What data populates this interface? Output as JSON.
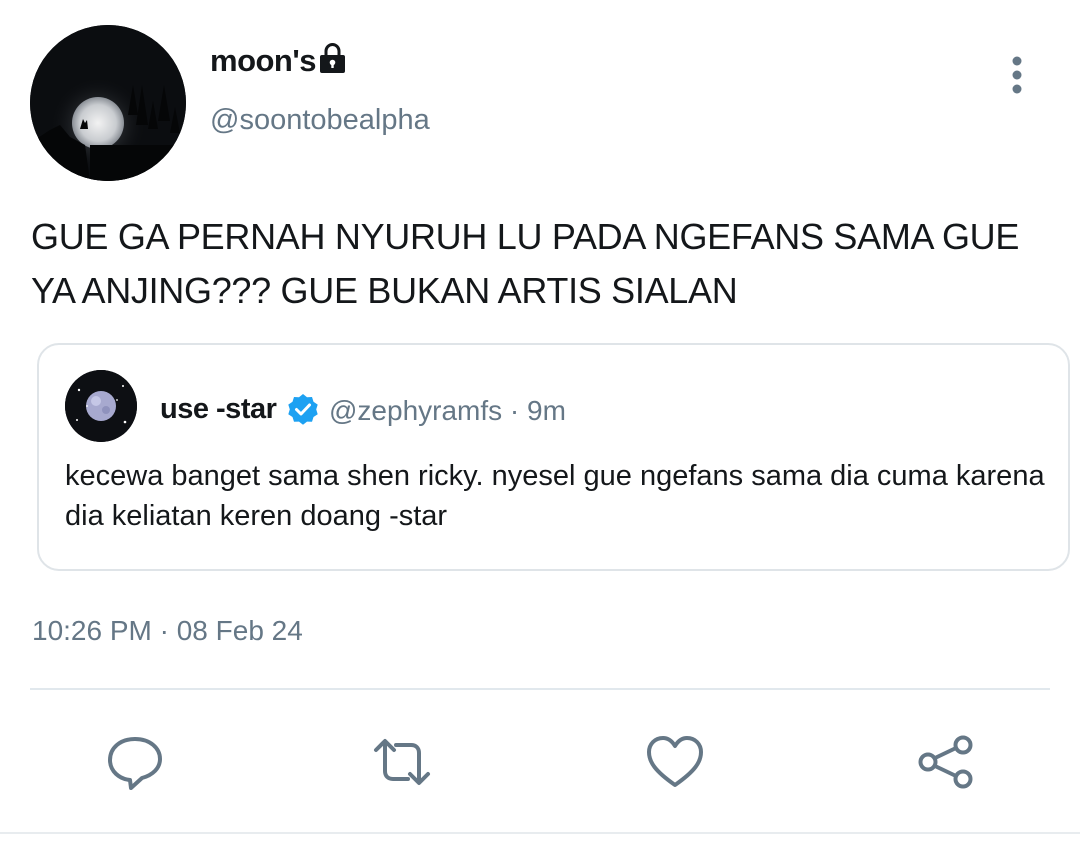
{
  "tweet": {
    "display_name": "moon's",
    "handle": "@soontobealpha",
    "text": "GUE GA PERNAH NYURUH LU PADA NGEFANS SAMA GUE YA ANJING??? GUE BUKAN ARTIS SIALAN",
    "timestamp": "10:26 PM · 08 Feb 24",
    "locked": true
  },
  "quoted_tweet": {
    "display_name": "use -star",
    "verified": true,
    "handle_time": "@zephyramfs · 9m",
    "text": "kecewa banget sama shen ricky. nyesel gue ngefans sama dia cuma karena dia keliatan keren doang -star"
  },
  "actions": {
    "reply": "reply-icon",
    "retweet": "retweet-icon",
    "like": "like-icon",
    "share": "share-icon"
  },
  "colors": {
    "secondary_text": "#657786",
    "icon": "#657786",
    "verified": "#1da1f2",
    "border": "#dfe4e8"
  }
}
